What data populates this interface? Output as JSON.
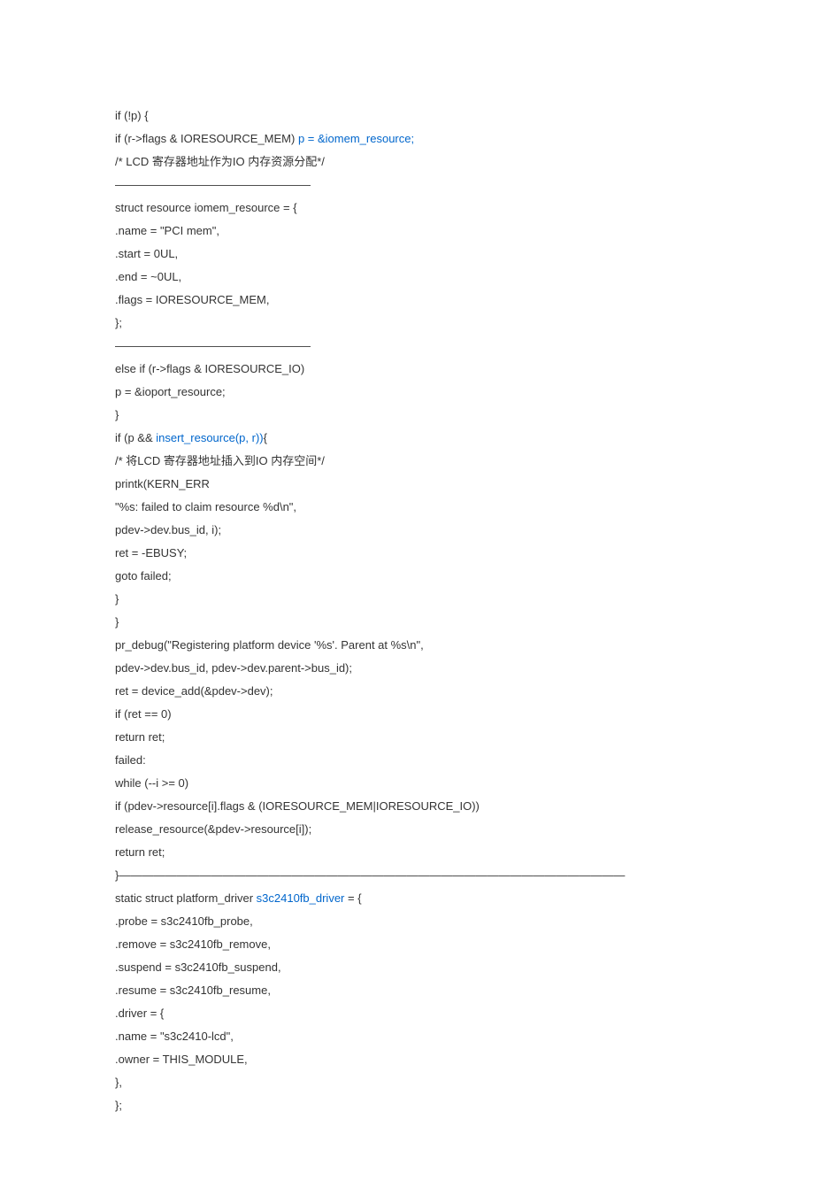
{
  "lines": [
    {
      "type": "plain",
      "text": "if (!p) {"
    },
    {
      "type": "mixed",
      "parts": [
        {
          "text": "if (r->flags & IORESOURCE_MEM) ",
          "blue": false
        },
        {
          "text": "p = &iomem_resource;",
          "blue": true
        }
      ]
    },
    {
      "type": "plain",
      "text": "/* LCD 寄存器地址作为IO 内存资源分配*/"
    },
    {
      "type": "plain",
      "text": "―――――――――――――――――"
    },
    {
      "type": "plain",
      "text": "struct resource iomem_resource = {"
    },
    {
      "type": "plain",
      "text": ".name = \"PCI mem\","
    },
    {
      "type": "plain",
      "text": ".start = 0UL,"
    },
    {
      "type": "plain",
      "text": ".end = ~0UL,"
    },
    {
      "type": "plain",
      "text": ".flags = IORESOURCE_MEM,"
    },
    {
      "type": "plain",
      "text": "};"
    },
    {
      "type": "plain",
      "text": "―――――――――――――――――"
    },
    {
      "type": "plain",
      "text": "else if (r->flags & IORESOURCE_IO)"
    },
    {
      "type": "plain",
      "text": "p = &ioport_resource;"
    },
    {
      "type": "plain",
      "text": "}"
    },
    {
      "type": "mixed",
      "parts": [
        {
          "text": "if (p && ",
          "blue": false
        },
        {
          "text": "insert_resource(p, r))",
          "blue": true
        },
        {
          "text": "{",
          "blue": false
        }
      ]
    },
    {
      "type": "plain",
      "text": "/* 将LCD 寄存器地址插入到IO 内存空间*/"
    },
    {
      "type": "plain",
      "text": "printk(KERN_ERR"
    },
    {
      "type": "plain",
      "text": "\"%s: failed to claim resource %d\\n\","
    },
    {
      "type": "plain",
      "text": "pdev->dev.bus_id, i);"
    },
    {
      "type": "plain",
      "text": "ret = -EBUSY;"
    },
    {
      "type": "plain",
      "text": "goto failed;"
    },
    {
      "type": "plain",
      "text": "}"
    },
    {
      "type": "plain",
      "text": "}"
    },
    {
      "type": "plain",
      "text": "pr_debug(\"Registering platform device '%s'. Parent at %s\\n\","
    },
    {
      "type": "plain",
      "text": "pdev->dev.bus_id, pdev->dev.parent->bus_id);"
    },
    {
      "type": "plain",
      "text": "ret = device_add(&pdev->dev);"
    },
    {
      "type": "plain",
      "text": "if (ret == 0)"
    },
    {
      "type": "plain",
      "text": "return ret;"
    },
    {
      "type": "plain",
      "text": "failed:"
    },
    {
      "type": "plain",
      "text": "while (--i >= 0)"
    },
    {
      "type": "plain",
      "text": "if (pdev->resource[i].flags & (IORESOURCE_MEM|IORESOURCE_IO))"
    },
    {
      "type": "plain",
      "text": "release_resource(&pdev->resource[i]);"
    },
    {
      "type": "plain",
      "text": "return ret;"
    },
    {
      "type": "plain",
      "text": "}――――――――――――――――――――――――――――――――――――――――――――"
    },
    {
      "type": "mixed",
      "parts": [
        {
          "text": "static struct platform_driver ",
          "blue": false
        },
        {
          "text": "s3c2410fb_driver",
          "blue": true
        },
        {
          "text": " = {",
          "blue": false
        }
      ]
    },
    {
      "type": "plain",
      "text": ".probe = s3c2410fb_probe,"
    },
    {
      "type": "plain",
      "text": ".remove = s3c2410fb_remove,"
    },
    {
      "type": "plain",
      "text": ".suspend = s3c2410fb_suspend,"
    },
    {
      "type": "plain",
      "text": ".resume = s3c2410fb_resume,"
    },
    {
      "type": "plain",
      "text": ".driver = {"
    },
    {
      "type": "plain",
      "text": ".name = \"s3c2410-lcd\","
    },
    {
      "type": "plain",
      "text": ".owner = THIS_MODULE,"
    },
    {
      "type": "plain",
      "text": "},"
    },
    {
      "type": "plain",
      "text": "};"
    }
  ]
}
